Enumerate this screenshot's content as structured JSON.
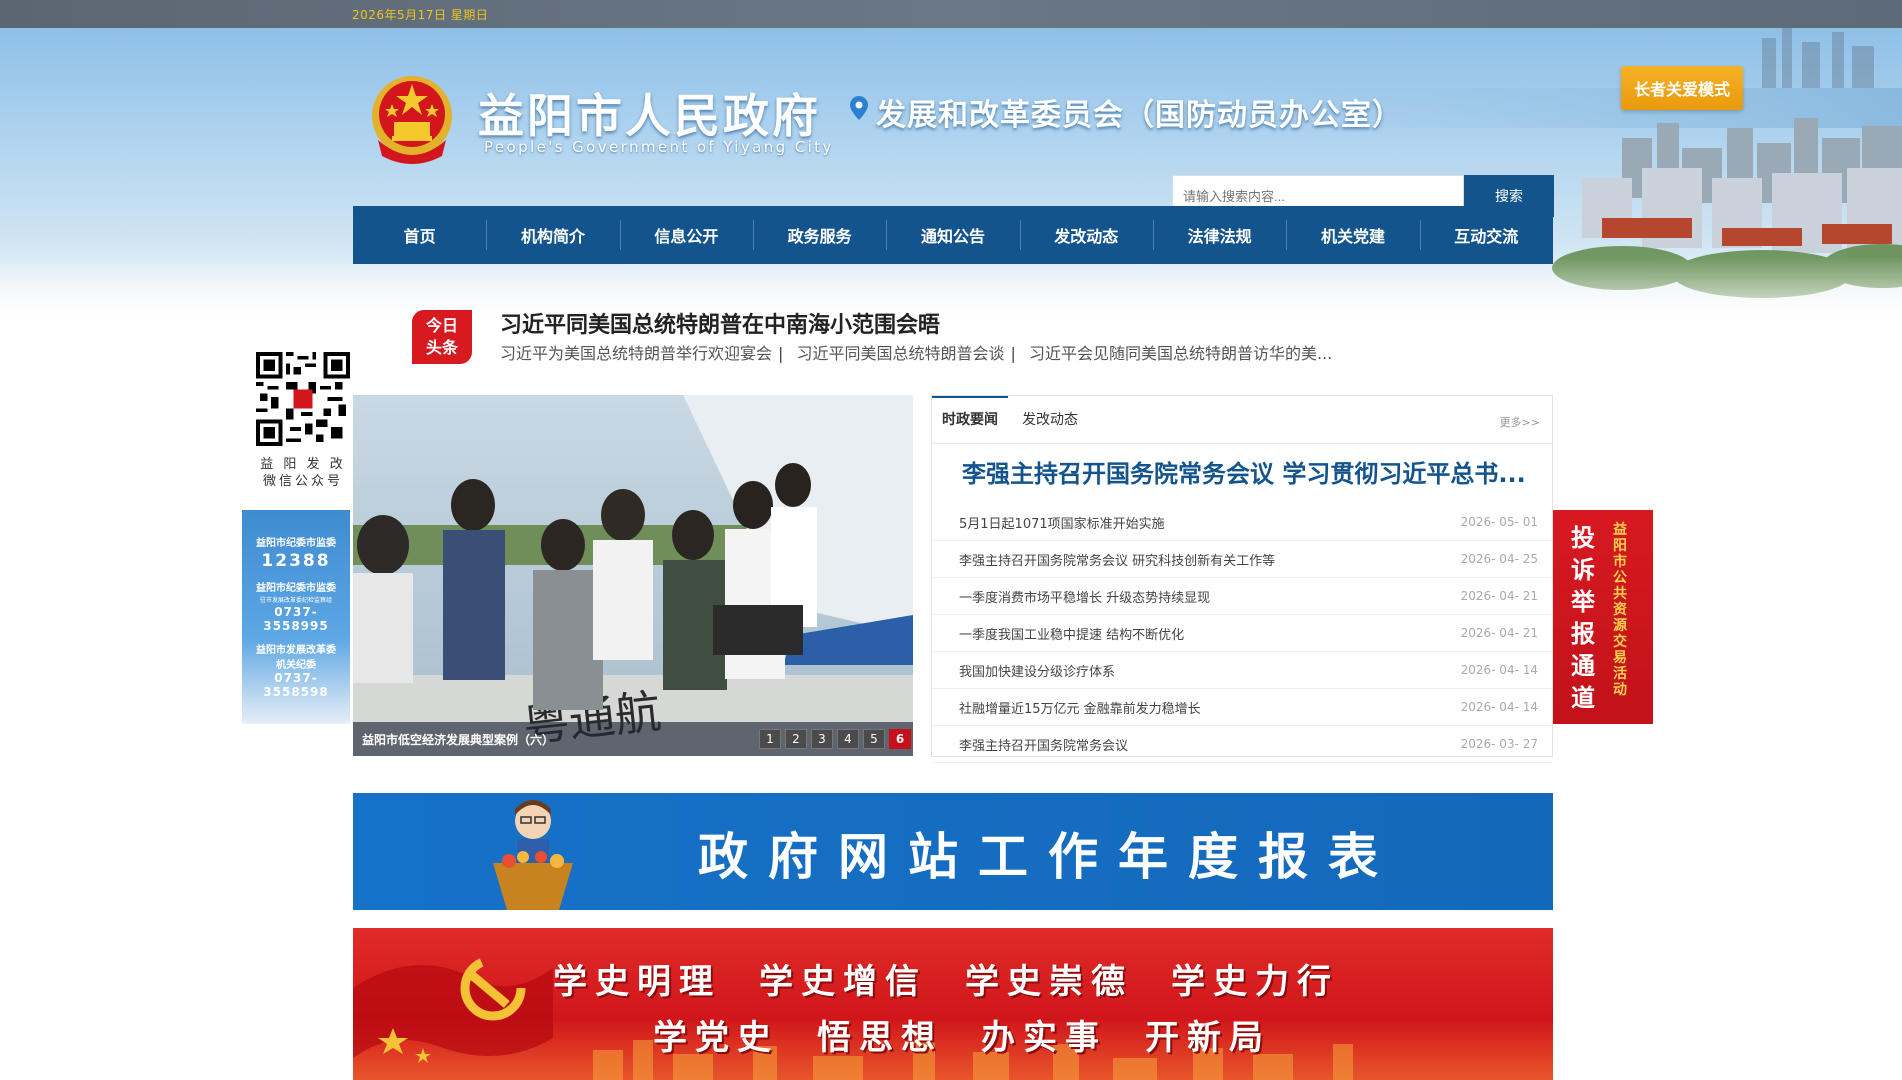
{
  "topbar": {
    "date": "2026年5月17日 星期日"
  },
  "header": {
    "site_title": "益阳市人民政府",
    "site_subtitle": "People's Government of Yiyang City",
    "department": "发展和改革委员会（国防动员办公室）",
    "care_mode": "长者关爱模式",
    "search_placeholder": "请输入搜索内容...",
    "search_button": "搜索"
  },
  "nav": [
    "首页",
    "机构简介",
    "信息公开",
    "政务服务",
    "通知公告",
    "发改动态",
    "法律法规",
    "机关党建",
    "互动交流"
  ],
  "headline": {
    "badge_line1": "今日",
    "badge_line2": "头条",
    "title": "习近平同美国总统特朗普在中南海小范围会晤",
    "subs": [
      "习近平为美国总统特朗普举行欢迎宴会",
      "习近平同美国总统特朗普会谈",
      "习近平会见随同美国总统特朗普访华的美..."
    ]
  },
  "left": {
    "qr_label_line1": "益 阳 发 改",
    "qr_label_line2": "微信公众号",
    "jw": {
      "line1": "益阳市纪委市监委",
      "number1": "12388",
      "line2": "益阳市纪委市监委",
      "tiny": "驻市发展改革委纪检监察组",
      "number2": "0737-3558995",
      "line3": "益阳市发展改革委",
      "line4": "机关纪委",
      "number3": "0737-3558598"
    }
  },
  "right_ad": {
    "big": "投诉举报通道",
    "small": "益阳市公共资源交易活动"
  },
  "slide": {
    "caption": "益阳市低空经济发展典型案例（六）",
    "pages": [
      "1",
      "2",
      "3",
      "4",
      "5",
      "6"
    ],
    "active": "6"
  },
  "news": {
    "tabs": [
      "时政要闻",
      "发改动态"
    ],
    "more": "更多>>",
    "headline": "李强主持召开国务院常务会议 学习贯彻习近平总书...",
    "items": [
      {
        "title": "5月1日起1071项国家标准开始实施",
        "date": "2026- 05- 01"
      },
      {
        "title": "李强主持召开国务院常务会议 研究科技创新有关工作等",
        "date": "2026- 04- 25"
      },
      {
        "title": "一季度消费市场平稳增长 升级态势持续显现",
        "date": "2026- 04- 21"
      },
      {
        "title": "一季度我国工业稳中提速 结构不断优化",
        "date": "2026- 04- 21"
      },
      {
        "title": "我国加快建设分级诊疗体系",
        "date": "2026- 04- 14"
      },
      {
        "title": "社融增量近15万亿元 金融靠前发力稳增长",
        "date": "2026- 04- 14"
      },
      {
        "title": "李强主持召开国务院常务会议",
        "date": "2026- 03- 27"
      }
    ]
  },
  "banners": {
    "report": "政府网站工作年度报表",
    "party_line1": [
      "学史明理",
      "学史增信",
      "学史崇德",
      "学史力行"
    ],
    "party_line2": [
      "学党史",
      "悟思想",
      "办实事",
      "开新局"
    ]
  },
  "colors": {
    "nav_blue": "#14548d",
    "accent_red": "#d71920",
    "care_orange": "#f0a11b"
  }
}
